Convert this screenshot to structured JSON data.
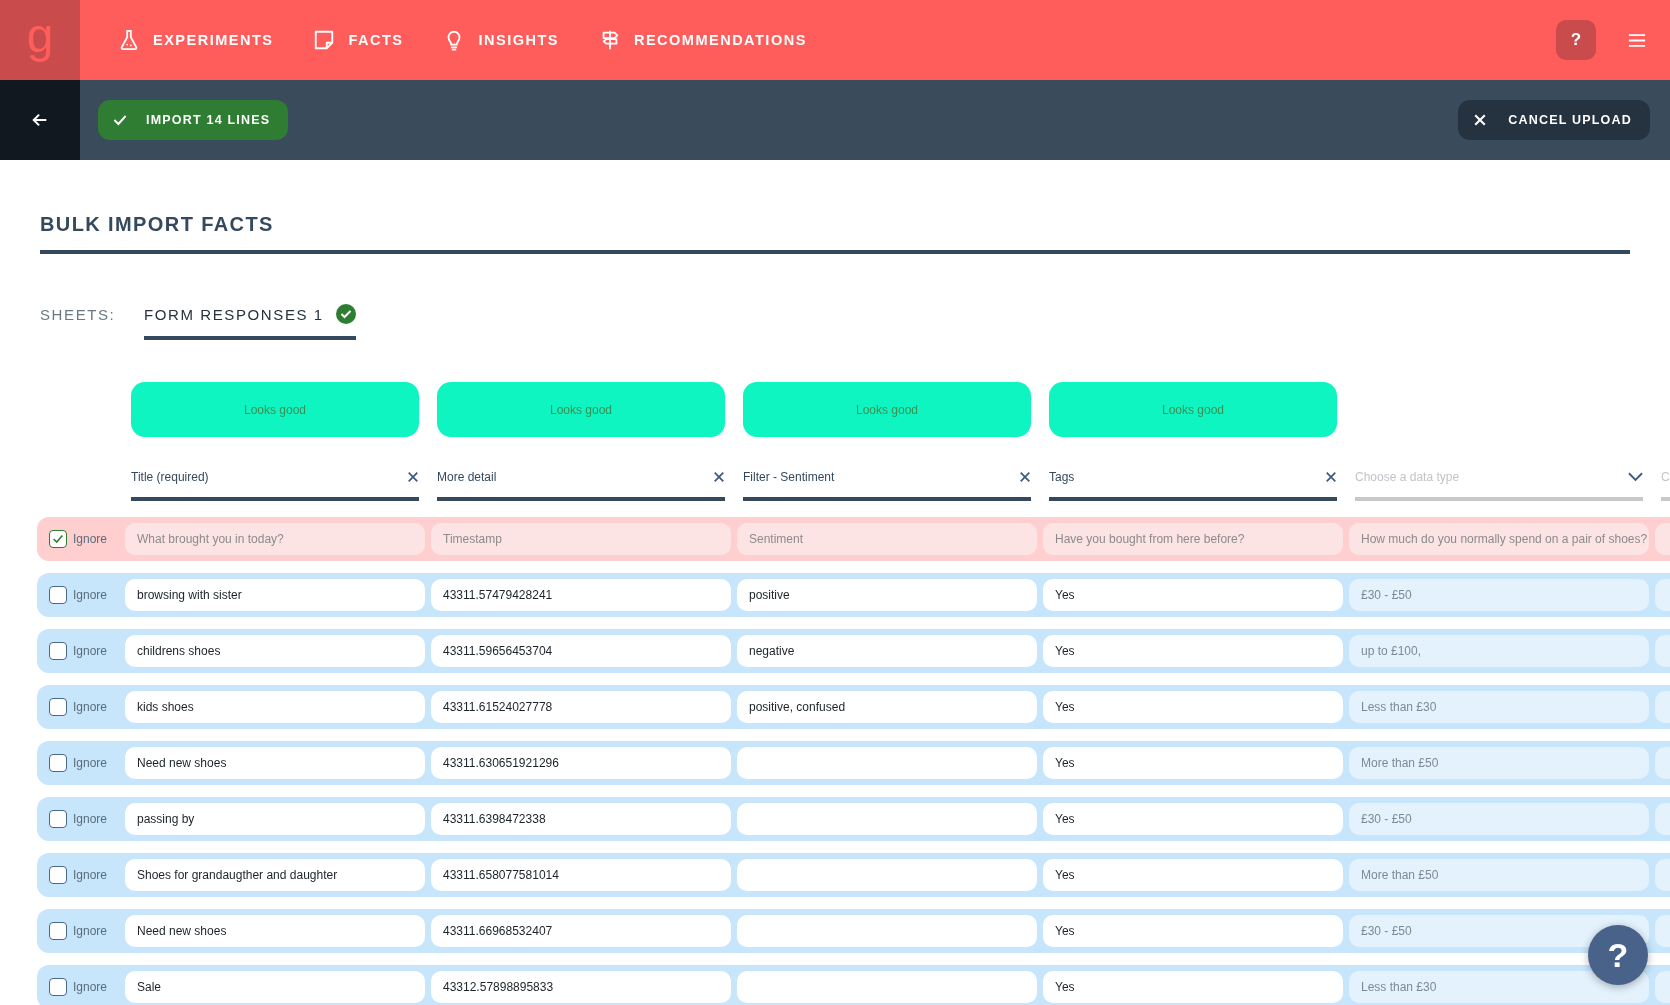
{
  "logo": "g",
  "nav": [
    {
      "label": "EXPERIMENTS"
    },
    {
      "label": "FACTS"
    },
    {
      "label": "INSIGHTS"
    },
    {
      "label": "RECOMMENDATIONS"
    }
  ],
  "help_button": "?",
  "toolbar": {
    "import_button": "IMPORT 14 LINES",
    "cancel_button": "CANCEL UPLOAD"
  },
  "page_title": "BULK IMPORT FACTS",
  "sheets": {
    "label": "SHEETS:",
    "tabs": [
      {
        "label": "FORM RESPONSES 1",
        "selected": true,
        "valid": true
      }
    ]
  },
  "columns": [
    {
      "status": "Looks good",
      "field": "Title (required)",
      "mapped": true
    },
    {
      "status": "Looks good",
      "field": "More detail",
      "mapped": true
    },
    {
      "status": "Looks good",
      "field": "Filter - Sentiment",
      "mapped": true
    },
    {
      "status": "Looks good",
      "field": "Tags",
      "mapped": true
    },
    {
      "placeholder": "Choose a data type",
      "mapped": false
    },
    {
      "placeholder": "C",
      "mapped": false
    }
  ],
  "rows": [
    {
      "ignore_label": "Ignore",
      "checked": true,
      "cells": [
        "What brought you in today?",
        "Timestamp",
        "Sentiment",
        "Have you bought from here before?",
        "How much do you normally spend on a pair of shoes?"
      ]
    },
    {
      "ignore_label": "Ignore",
      "checked": false,
      "cells": [
        "browsing with sister",
        "43311.57479428241",
        "positive",
        "Yes",
        "£30 - £50"
      ]
    },
    {
      "ignore_label": "Ignore",
      "checked": false,
      "cells": [
        "childrens shoes",
        "43311.59656453704",
        "negative",
        "Yes",
        "up to £100,"
      ]
    },
    {
      "ignore_label": "Ignore",
      "checked": false,
      "cells": [
        "kids shoes",
        "43311.61524027778",
        "positive, confused",
        "Yes",
        "Less than £30"
      ]
    },
    {
      "ignore_label": "Ignore",
      "checked": false,
      "cells": [
        "Need new shoes",
        "43311.630651921296",
        "",
        "Yes",
        "More than £50"
      ]
    },
    {
      "ignore_label": "Ignore",
      "checked": false,
      "cells": [
        "passing by",
        "43311.6398472338",
        "",
        "Yes",
        "£30 - £50"
      ]
    },
    {
      "ignore_label": "Ignore",
      "checked": false,
      "cells": [
        "Shoes for grandaugther and daughter",
        "43311.658077581014",
        "",
        "Yes",
        "More than £50"
      ]
    },
    {
      "ignore_label": "Ignore",
      "checked": false,
      "cells": [
        "Need new shoes",
        "43311.66968532407",
        "",
        "Yes",
        "£30 - £50"
      ]
    },
    {
      "ignore_label": "Ignore",
      "checked": false,
      "cells": [
        "Sale",
        "43312.57898895833",
        "",
        "Yes",
        "Less than £30"
      ]
    }
  ],
  "fab": "?"
}
